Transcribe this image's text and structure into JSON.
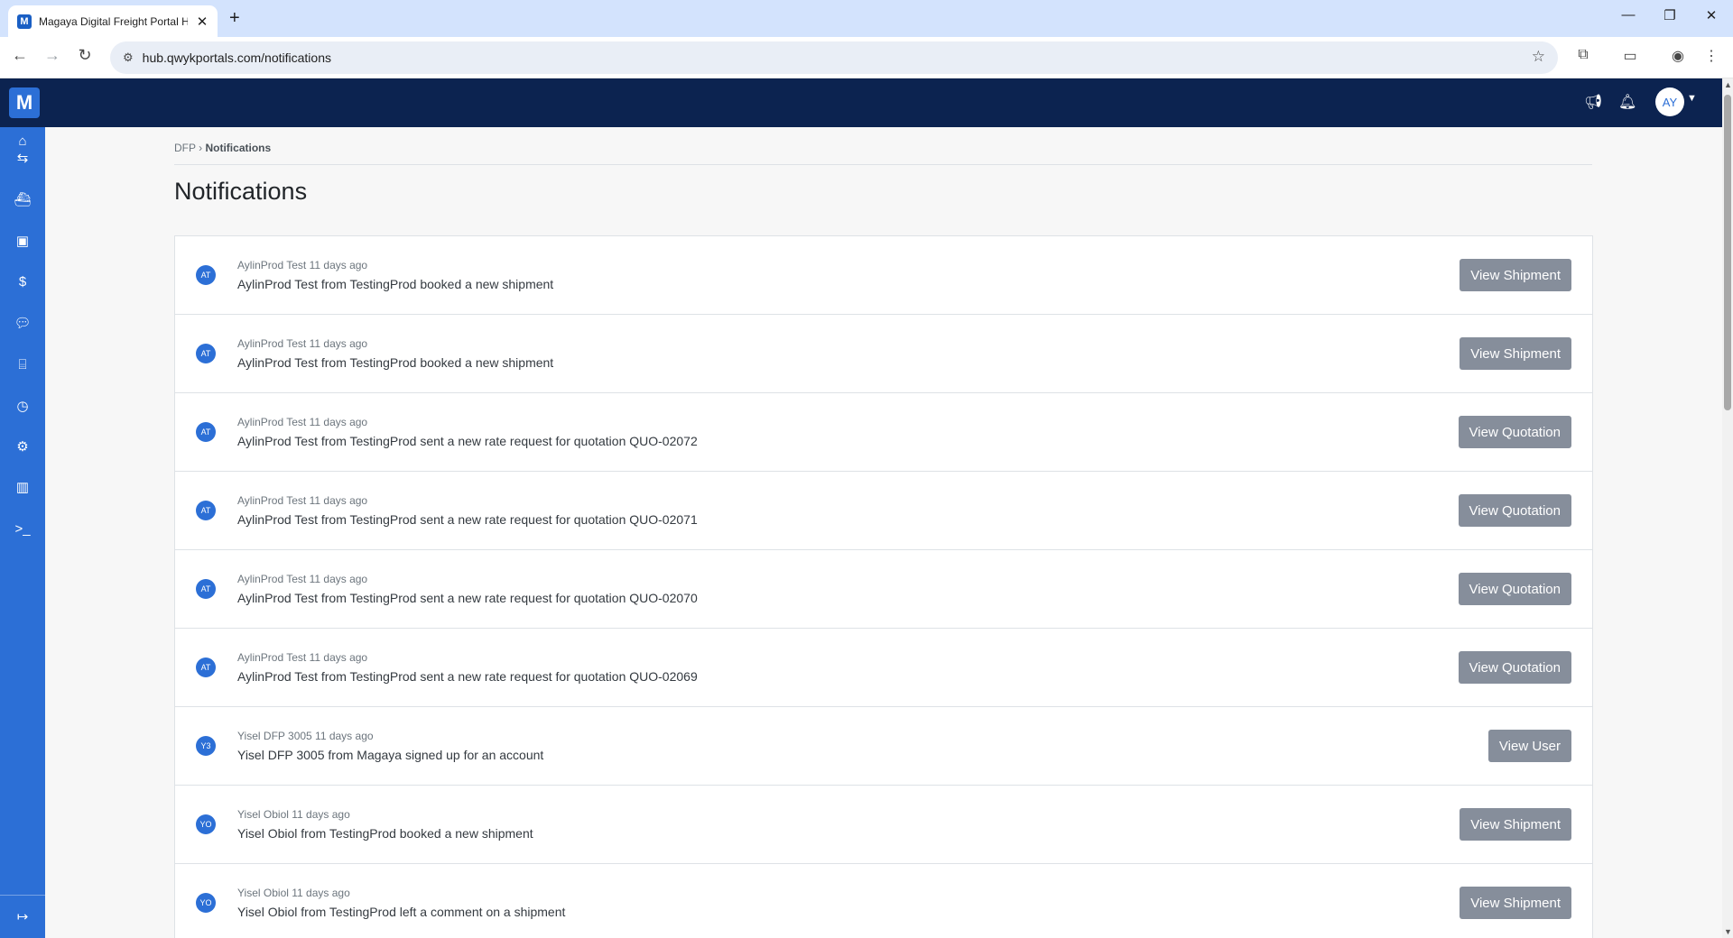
{
  "browser": {
    "tab_title": "Magaya Digital Freight Portal H",
    "url": "hub.qwykportals.com/notifications"
  },
  "header": {
    "logo_text": "M",
    "user_initials": "AY"
  },
  "sidebar": {
    "items": [
      {
        "icon": "home-icon"
      },
      {
        "icon": "shipments-icon"
      },
      {
        "icon": "cargo-icon"
      },
      {
        "icon": "inventory-icon"
      },
      {
        "icon": "dollar-icon"
      },
      {
        "icon": "comments-icon"
      },
      {
        "icon": "warehouse-icon"
      },
      {
        "icon": "clock-icon"
      },
      {
        "icon": "settings-icon"
      },
      {
        "icon": "library-icon"
      },
      {
        "icon": "terminal-icon"
      }
    ],
    "collapse_icon": "expand-icon"
  },
  "breadcrumb": {
    "root": "DFP",
    "separator": "›",
    "current": "Notifications"
  },
  "page": {
    "title": "Notifications"
  },
  "notifications": [
    {
      "initials": "AT",
      "meta": "AylinProd Test 11 days ago",
      "message": "AylinProd Test from TestingProd booked a new shipment",
      "action": "View Shipment"
    },
    {
      "initials": "AT",
      "meta": "AylinProd Test 11 days ago",
      "message": "AylinProd Test from TestingProd booked a new shipment",
      "action": "View Shipment"
    },
    {
      "initials": "AT",
      "meta": "AylinProd Test 11 days ago",
      "message": "AylinProd Test from TestingProd sent a new rate request for quotation QUO-02072",
      "action": "View Quotation"
    },
    {
      "initials": "AT",
      "meta": "AylinProd Test 11 days ago",
      "message": "AylinProd Test from TestingProd sent a new rate request for quotation QUO-02071",
      "action": "View Quotation"
    },
    {
      "initials": "AT",
      "meta": "AylinProd Test 11 days ago",
      "message": "AylinProd Test from TestingProd sent a new rate request for quotation QUO-02070",
      "action": "View Quotation"
    },
    {
      "initials": "AT",
      "meta": "AylinProd Test 11 days ago",
      "message": "AylinProd Test from TestingProd sent a new rate request for quotation QUO-02069",
      "action": "View Quotation"
    },
    {
      "initials": "Y3",
      "meta": "Yisel DFP 3005 11 days ago",
      "message": "Yisel DFP 3005 from Magaya signed up for an account",
      "action": "View User"
    },
    {
      "initials": "YO",
      "meta": "Yisel Obiol 11 days ago",
      "message": "Yisel Obiol from TestingProd booked a new shipment",
      "action": "View Shipment"
    },
    {
      "initials": "YO",
      "meta": "Yisel Obiol 11 days ago",
      "message": "Yisel Obiol from TestingProd left a comment on a shipment",
      "action": "View Shipment"
    }
  ],
  "colors": {
    "header_bg": "#0c2350",
    "sidebar_bg": "#2c6fd6",
    "button_bg": "#868e9b"
  }
}
